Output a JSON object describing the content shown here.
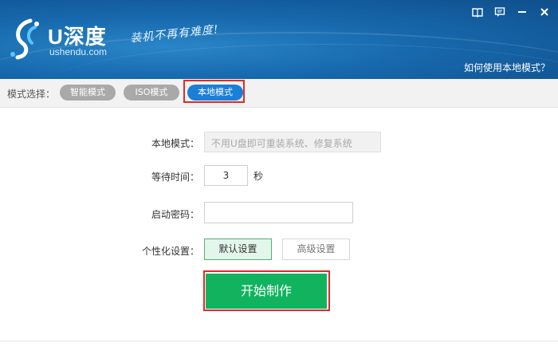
{
  "header": {
    "brand_main": "U深度",
    "brand_sub": "ushendu.com",
    "slogan": "装机不再有难度!",
    "help_link": "如何使用本地模式？",
    "window_buttons": [
      "book-icon",
      "message-icon",
      "minimize-icon",
      "close-icon"
    ]
  },
  "mode_bar": {
    "label": "模式选择：",
    "modes": [
      "智能模式",
      "ISO模式",
      "本地模式"
    ],
    "selected": "本地模式"
  },
  "form": {
    "local_mode_label": "本地模式：",
    "local_mode_placeholder": "不用U盘即可重装系统、修复系统",
    "wait_time_label": "等待时间：",
    "wait_time_value": "3",
    "wait_time_unit": "秒",
    "boot_password_label": "启动密码：",
    "boot_password_value": "",
    "personalize_label": "个性化设置：",
    "default_settings": "默认设置",
    "advanced_settings": "高级设置",
    "start_button": "开始制作"
  },
  "colors": {
    "header_blue": "#1769ad",
    "selected_mode": "#1a7fd8",
    "start_green": "#11b35f",
    "highlight_red": "#e02a2a"
  }
}
